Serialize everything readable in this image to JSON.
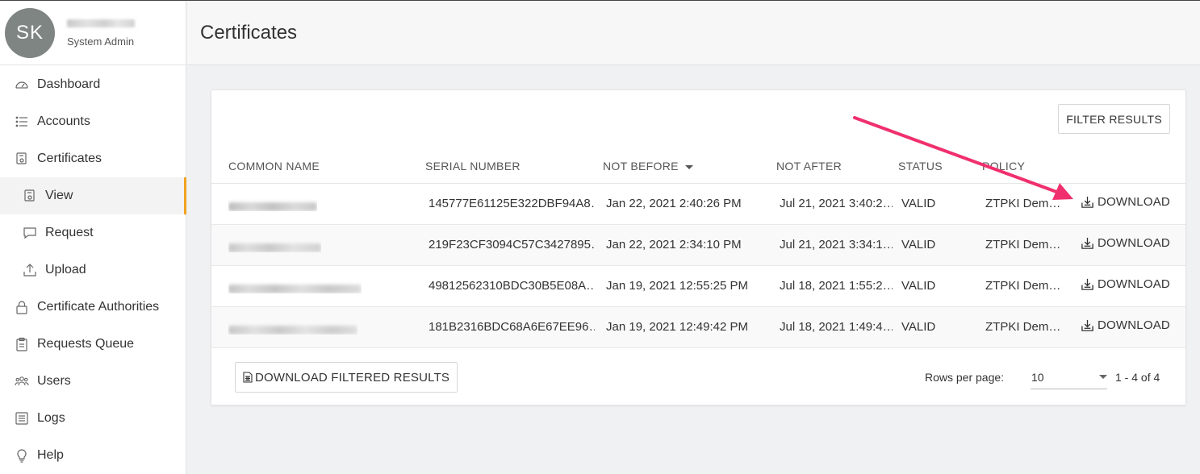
{
  "user": {
    "initials": "SK",
    "role": "System Admin"
  },
  "nav": {
    "dashboard": "Dashboard",
    "accounts": "Accounts",
    "certificates": "Certificates",
    "view": "View",
    "request": "Request",
    "upload": "Upload",
    "certificate_authorities": "Certificate Authorities",
    "requests_queue": "Requests Queue",
    "users": "Users",
    "logs": "Logs",
    "help": "Help"
  },
  "page": {
    "title": "Certificates"
  },
  "toolbar": {
    "filter_label": "FILTER RESULTS"
  },
  "table": {
    "columns": {
      "common_name": "COMMON NAME",
      "serial_number": "SERIAL NUMBER",
      "not_before": "NOT BEFORE",
      "not_after": "NOT AFTER",
      "status": "STATUS",
      "policy": "POLICY"
    },
    "rows": [
      {
        "serial": "145777E61125E322DBF94A8…",
        "not_before": "Jan 22, 2021 2:40:26 PM",
        "not_after": "Jul 21, 2021 3:40:2…",
        "status": "VALID",
        "policy": "ZTPKI Dem…",
        "action": "DOWNLOAD"
      },
      {
        "serial": "219F23CF3094C57C3427895…",
        "not_before": "Jan 22, 2021 2:34:10 PM",
        "not_after": "Jul 21, 2021 3:34:1…",
        "status": "VALID",
        "policy": "ZTPKI Dem…",
        "action": "DOWNLOAD"
      },
      {
        "serial": "49812562310BDC30B5E08A…",
        "not_before": "Jan 19, 2021 12:55:25 PM",
        "not_after": "Jul 18, 2021 1:55:2…",
        "status": "VALID",
        "policy": "ZTPKI Dem…",
        "action": "DOWNLOAD"
      },
      {
        "serial": "181B2316BDC68A6E67EE96…",
        "not_before": "Jan 19, 2021 12:49:42 PM",
        "not_after": "Jul 18, 2021 1:49:4…",
        "status": "VALID",
        "policy": "ZTPKI Dem…",
        "action": "DOWNLOAD"
      }
    ]
  },
  "footer": {
    "download_filtered_label": "DOWNLOAD FILTERED RESULTS",
    "rows_per_page_label": "Rows per page:",
    "rows_per_page_value": "10",
    "range_label": "1 - 4 of 4"
  },
  "colors": {
    "accent": "#f0a322",
    "annotation_arrow": "#f0306e",
    "avatar_bg": "#7f8583"
  }
}
